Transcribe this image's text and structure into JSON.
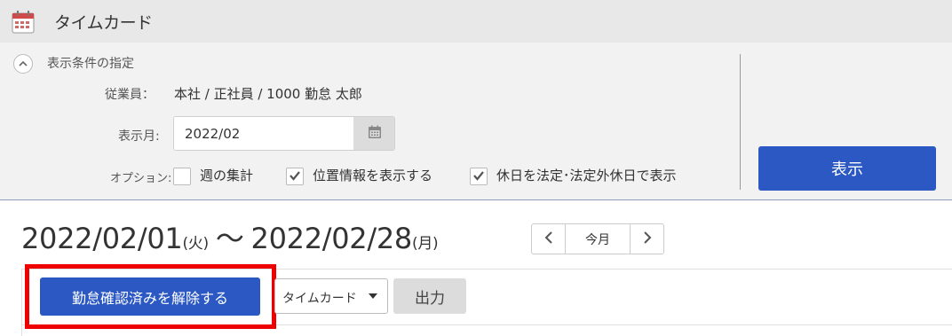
{
  "header": {
    "title": "タイムカード",
    "icon": "calendar-icon",
    "icon_color": "#c0392b"
  },
  "filter": {
    "section_title": "表示条件の指定",
    "employee_label": "従業員：",
    "employee_value": "本社 / 正社員 / 1000 勤怠 太郎",
    "month_label": "表示月:",
    "month_value": "2022/02",
    "option_label": "オプション:",
    "options": [
      {
        "label": "週の集計",
        "checked": false
      },
      {
        "label": "位置情報を表示する",
        "checked": true
      },
      {
        "label": "休日を法定･法定外休日で表示",
        "checked": true
      }
    ],
    "show_button": "表示"
  },
  "period": {
    "start": "2022/02/01",
    "start_dow": "(火)",
    "separator": "～",
    "end": "2022/02/28",
    "end_dow": "(月)"
  },
  "pager": {
    "prev_icon": "chevron-left-icon",
    "this_month": "今月",
    "next_icon": "chevron-right-icon"
  },
  "actions": {
    "unconfirm_button": "勤怠確認済みを解除する",
    "report_select": "タイムカード",
    "output_button": "出力"
  },
  "colors": {
    "primary": "#2b58c2",
    "highlight": "#ee0000"
  }
}
